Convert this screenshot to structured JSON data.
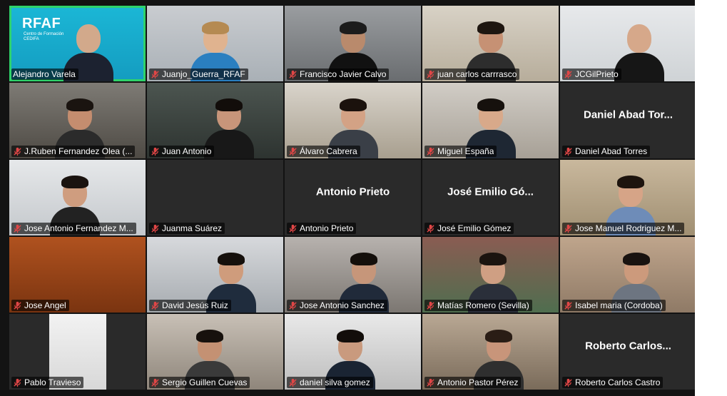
{
  "meeting": {
    "accent_color": "#2fd36b",
    "muted_icon": "mic-off-icon",
    "logo": {
      "text": "RFAF",
      "subtext_line1": "Centro de Formación",
      "subtext_line2": "CEDIFA"
    }
  },
  "participants": [
    {
      "name": "Alejandro Varela",
      "muted": false,
      "video": true,
      "active": true
    },
    {
      "name": "Juanjo_Guerra_RFAF",
      "muted": true,
      "video": true
    },
    {
      "name": "Francisco Javier Calvo",
      "muted": true,
      "video": true
    },
    {
      "name": "juan carlos carrrasco",
      "muted": true,
      "video": true
    },
    {
      "name": "JCGilPrieto",
      "muted": true,
      "video": true
    },
    {
      "name": "J.Ruben Fernandez Olea (...",
      "muted": true,
      "video": true
    },
    {
      "name": "Juan Antonio",
      "muted": true,
      "video": true
    },
    {
      "name": "Álvaro Cabrera",
      "muted": true,
      "video": true
    },
    {
      "name": "Miguel España",
      "muted": true,
      "video": true
    },
    {
      "name": "Daniel Abad Torres",
      "display": "Daniel Abad Tor...",
      "muted": true,
      "video": false
    },
    {
      "name": "Jose Antonio Fernandez M...",
      "muted": true,
      "video": true
    },
    {
      "name": "Juanma Suárez",
      "muted": true,
      "video": false
    },
    {
      "name": "Antonio Prieto",
      "display": "Antonio Prieto",
      "muted": true,
      "video": false
    },
    {
      "name": "José Emilio Gómez",
      "display": "José Emilio Gó...",
      "muted": true,
      "video": false
    },
    {
      "name": "Jose Manuel Rodriguez M...",
      "muted": true,
      "video": true
    },
    {
      "name": "Jose Angel",
      "muted": true,
      "video": true
    },
    {
      "name": "David Jesús Ruiz",
      "muted": true,
      "video": true
    },
    {
      "name": "Jose Antonio Sanchez",
      "muted": true,
      "video": true
    },
    {
      "name": "Matías Romero (Sevilla)",
      "muted": true,
      "video": true
    },
    {
      "name": "Isabel maria (Cordoba)",
      "muted": true,
      "video": true
    },
    {
      "name": "Pablo Travieso",
      "muted": true,
      "video": true
    },
    {
      "name": "Sergio Guillen Cuevas",
      "muted": true,
      "video": true
    },
    {
      "name": "daniel silva gomez",
      "muted": true,
      "video": true
    },
    {
      "name": "Antonio Pastor Pérez",
      "muted": true,
      "video": true
    },
    {
      "name": "Roberto Carlos Castro",
      "display": "Roberto Carlos...",
      "muted": true,
      "video": false
    }
  ]
}
